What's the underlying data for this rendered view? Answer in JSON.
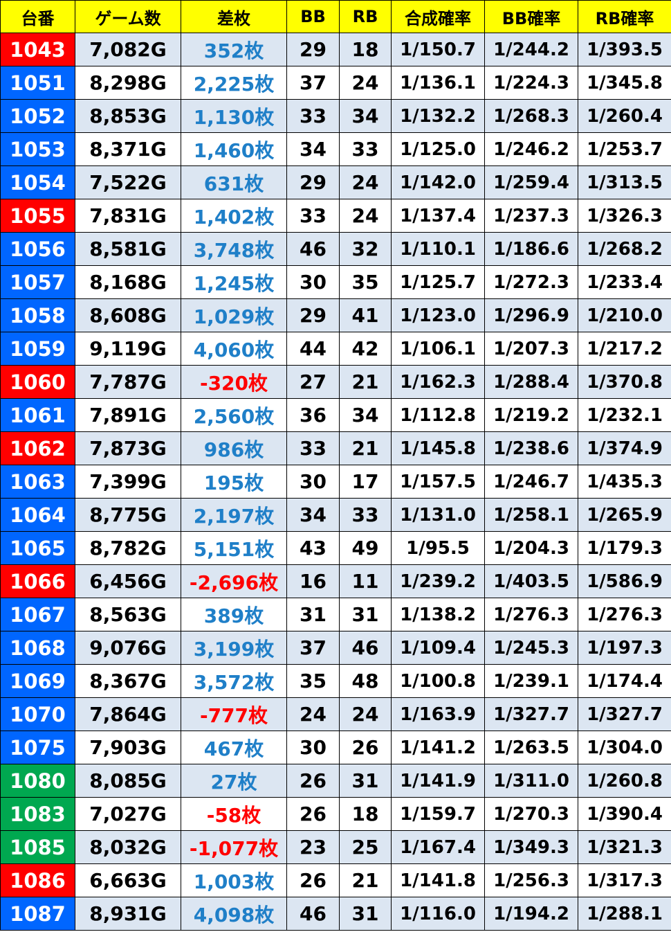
{
  "colors": {
    "header_bg": "#ffff00",
    "id_red": "#ff0000",
    "id_blue": "#0066ff",
    "id_green": "#00a850",
    "row_shade": "#dce6f2",
    "diff_positive": "#1f7fc8",
    "diff_negative": "#ff0000"
  },
  "table": {
    "headers": [
      "台番",
      "ゲーム数",
      "差枚",
      "BB",
      "RB",
      "合成確率",
      "BB確率",
      "RB確率"
    ],
    "rows": [
      {
        "id": "1043",
        "id_color": "red",
        "games": "7,082G",
        "diff": "352枚",
        "diff_sign": "pos",
        "bb": "29",
        "rb": "18",
        "total_rate": "1/150.7",
        "bb_rate": "1/244.2",
        "rb_rate": "1/393.5"
      },
      {
        "id": "1051",
        "id_color": "blue",
        "games": "8,298G",
        "diff": "2,225枚",
        "diff_sign": "pos",
        "bb": "37",
        "rb": "24",
        "total_rate": "1/136.1",
        "bb_rate": "1/224.3",
        "rb_rate": "1/345.8"
      },
      {
        "id": "1052",
        "id_color": "blue",
        "games": "8,853G",
        "diff": "1,130枚",
        "diff_sign": "pos",
        "bb": "33",
        "rb": "34",
        "total_rate": "1/132.2",
        "bb_rate": "1/268.3",
        "rb_rate": "1/260.4"
      },
      {
        "id": "1053",
        "id_color": "blue",
        "games": "8,371G",
        "diff": "1,460枚",
        "diff_sign": "pos",
        "bb": "34",
        "rb": "33",
        "total_rate": "1/125.0",
        "bb_rate": "1/246.2",
        "rb_rate": "1/253.7"
      },
      {
        "id": "1054",
        "id_color": "blue",
        "games": "7,522G",
        "diff": "631枚",
        "diff_sign": "pos",
        "bb": "29",
        "rb": "24",
        "total_rate": "1/142.0",
        "bb_rate": "1/259.4",
        "rb_rate": "1/313.5"
      },
      {
        "id": "1055",
        "id_color": "red",
        "games": "7,831G",
        "diff": "1,402枚",
        "diff_sign": "pos",
        "bb": "33",
        "rb": "24",
        "total_rate": "1/137.4",
        "bb_rate": "1/237.3",
        "rb_rate": "1/326.3"
      },
      {
        "id": "1056",
        "id_color": "blue",
        "games": "8,581G",
        "diff": "3,748枚",
        "diff_sign": "pos",
        "bb": "46",
        "rb": "32",
        "total_rate": "1/110.1",
        "bb_rate": "1/186.6",
        "rb_rate": "1/268.2"
      },
      {
        "id": "1057",
        "id_color": "blue",
        "games": "8,168G",
        "diff": "1,245枚",
        "diff_sign": "pos",
        "bb": "30",
        "rb": "35",
        "total_rate": "1/125.7",
        "bb_rate": "1/272.3",
        "rb_rate": "1/233.4"
      },
      {
        "id": "1058",
        "id_color": "blue",
        "games": "8,608G",
        "diff": "1,029枚",
        "diff_sign": "pos",
        "bb": "29",
        "rb": "41",
        "total_rate": "1/123.0",
        "bb_rate": "1/296.9",
        "rb_rate": "1/210.0"
      },
      {
        "id": "1059",
        "id_color": "blue",
        "games": "9,119G",
        "diff": "4,060枚",
        "diff_sign": "pos",
        "bb": "44",
        "rb": "42",
        "total_rate": "1/106.1",
        "bb_rate": "1/207.3",
        "rb_rate": "1/217.2"
      },
      {
        "id": "1060",
        "id_color": "red",
        "games": "7,787G",
        "diff": "-320枚",
        "diff_sign": "neg",
        "bb": "27",
        "rb": "21",
        "total_rate": "1/162.3",
        "bb_rate": "1/288.4",
        "rb_rate": "1/370.8"
      },
      {
        "id": "1061",
        "id_color": "blue",
        "games": "7,891G",
        "diff": "2,560枚",
        "diff_sign": "pos",
        "bb": "36",
        "rb": "34",
        "total_rate": "1/112.8",
        "bb_rate": "1/219.2",
        "rb_rate": "1/232.1"
      },
      {
        "id": "1062",
        "id_color": "red",
        "games": "7,873G",
        "diff": "986枚",
        "diff_sign": "pos",
        "bb": "33",
        "rb": "21",
        "total_rate": "1/145.8",
        "bb_rate": "1/238.6",
        "rb_rate": "1/374.9"
      },
      {
        "id": "1063",
        "id_color": "blue",
        "games": "7,399G",
        "diff": "195枚",
        "diff_sign": "pos",
        "bb": "30",
        "rb": "17",
        "total_rate": "1/157.5",
        "bb_rate": "1/246.7",
        "rb_rate": "1/435.3"
      },
      {
        "id": "1064",
        "id_color": "blue",
        "games": "8,775G",
        "diff": "2,197枚",
        "diff_sign": "pos",
        "bb": "34",
        "rb": "33",
        "total_rate": "1/131.0",
        "bb_rate": "1/258.1",
        "rb_rate": "1/265.9"
      },
      {
        "id": "1065",
        "id_color": "blue",
        "games": "8,782G",
        "diff": "5,151枚",
        "diff_sign": "pos",
        "bb": "43",
        "rb": "49",
        "total_rate": "1/95.5",
        "bb_rate": "1/204.3",
        "rb_rate": "1/179.3"
      },
      {
        "id": "1066",
        "id_color": "red",
        "games": "6,456G",
        "diff": "-2,696枚",
        "diff_sign": "neg",
        "bb": "16",
        "rb": "11",
        "total_rate": "1/239.2",
        "bb_rate": "1/403.5",
        "rb_rate": "1/586.9"
      },
      {
        "id": "1067",
        "id_color": "blue",
        "games": "8,563G",
        "diff": "389枚",
        "diff_sign": "pos",
        "bb": "31",
        "rb": "31",
        "total_rate": "1/138.2",
        "bb_rate": "1/276.3",
        "rb_rate": "1/276.3"
      },
      {
        "id": "1068",
        "id_color": "blue",
        "games": "9,076G",
        "diff": "3,199枚",
        "diff_sign": "pos",
        "bb": "37",
        "rb": "46",
        "total_rate": "1/109.4",
        "bb_rate": "1/245.3",
        "rb_rate": "1/197.3"
      },
      {
        "id": "1069",
        "id_color": "blue",
        "games": "8,367G",
        "diff": "3,572枚",
        "diff_sign": "pos",
        "bb": "35",
        "rb": "48",
        "total_rate": "1/100.8",
        "bb_rate": "1/239.1",
        "rb_rate": "1/174.4"
      },
      {
        "id": "1070",
        "id_color": "blue",
        "games": "7,864G",
        "diff": "-777枚",
        "diff_sign": "neg",
        "bb": "24",
        "rb": "24",
        "total_rate": "1/163.9",
        "bb_rate": "1/327.7",
        "rb_rate": "1/327.7"
      },
      {
        "id": "1075",
        "id_color": "blue",
        "games": "7,903G",
        "diff": "467枚",
        "diff_sign": "pos",
        "bb": "30",
        "rb": "26",
        "total_rate": "1/141.2",
        "bb_rate": "1/263.5",
        "rb_rate": "1/304.0"
      },
      {
        "id": "1080",
        "id_color": "green",
        "games": "8,085G",
        "diff": "27枚",
        "diff_sign": "pos",
        "bb": "26",
        "rb": "31",
        "total_rate": "1/141.9",
        "bb_rate": "1/311.0",
        "rb_rate": "1/260.8"
      },
      {
        "id": "1083",
        "id_color": "green",
        "games": "7,027G",
        "diff": "-58枚",
        "diff_sign": "neg",
        "bb": "26",
        "rb": "18",
        "total_rate": "1/159.7",
        "bb_rate": "1/270.3",
        "rb_rate": "1/390.4"
      },
      {
        "id": "1085",
        "id_color": "green",
        "games": "8,032G",
        "diff": "-1,077枚",
        "diff_sign": "neg",
        "bb": "23",
        "rb": "25",
        "total_rate": "1/167.4",
        "bb_rate": "1/349.3",
        "rb_rate": "1/321.3"
      },
      {
        "id": "1086",
        "id_color": "red",
        "games": "6,663G",
        "diff": "1,003枚",
        "diff_sign": "pos",
        "bb": "26",
        "rb": "21",
        "total_rate": "1/141.8",
        "bb_rate": "1/256.3",
        "rb_rate": "1/317.3"
      },
      {
        "id": "1087",
        "id_color": "blue",
        "games": "8,931G",
        "diff": "4,098枚",
        "diff_sign": "pos",
        "bb": "46",
        "rb": "31",
        "total_rate": "1/116.0",
        "bb_rate": "1/194.2",
        "rb_rate": "1/288.1"
      }
    ]
  }
}
